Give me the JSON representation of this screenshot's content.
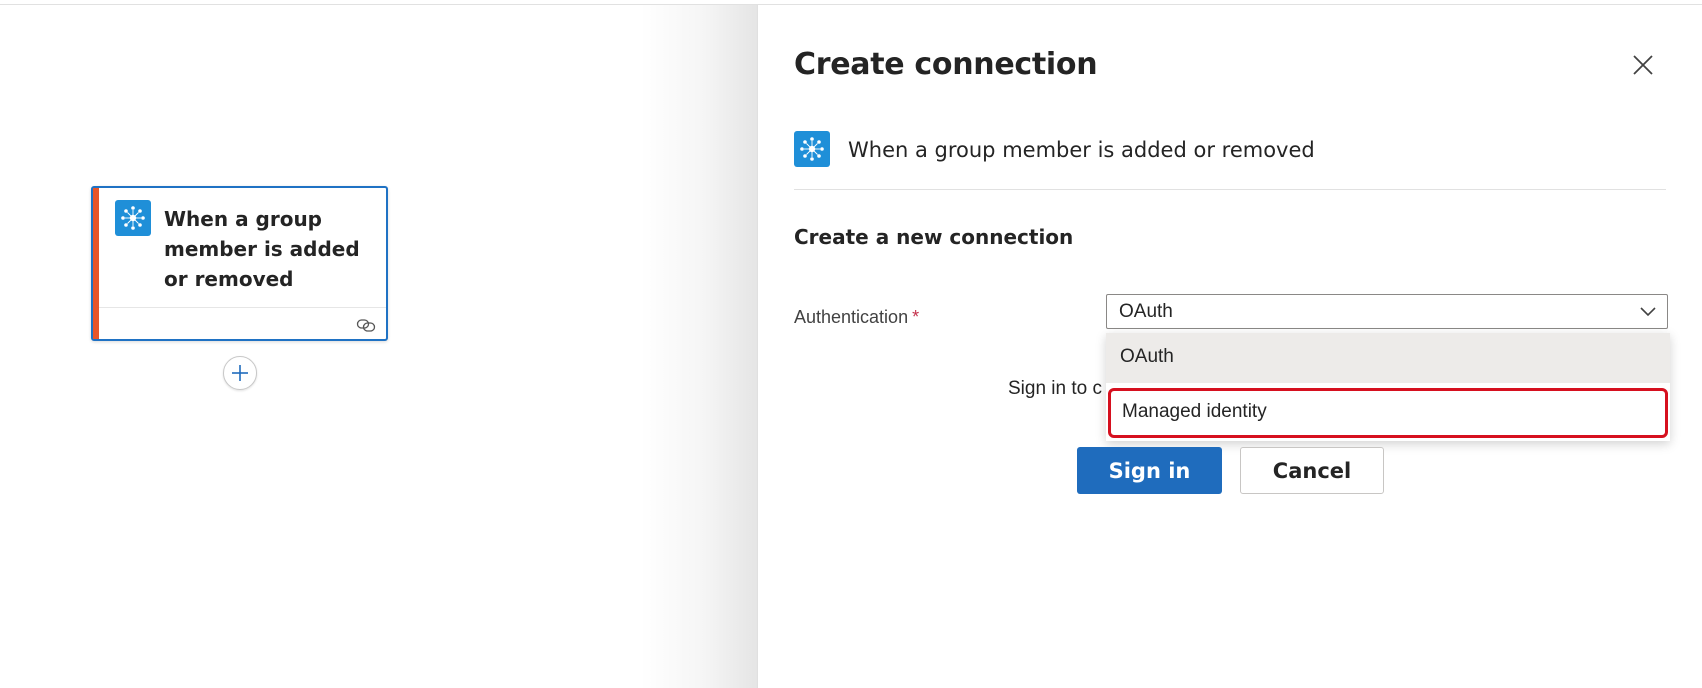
{
  "canvas": {
    "trigger_card": {
      "title": "When a group member is added or removed",
      "icon": "entra-id-hub-icon",
      "footer_icon": "connection-link-icon",
      "accent_color": "#e8562a",
      "border_color": "#1f72c4"
    },
    "add_step_icon": "plus-icon"
  },
  "panel": {
    "title": "Create connection",
    "close_icon": "close-icon",
    "operation": {
      "icon": "entra-id-hub-icon",
      "name": "When a group member is added or removed"
    },
    "section_heading": "Create a new connection",
    "authentication": {
      "label": "Authentication",
      "required_marker": "*",
      "selected_value": "OAuth",
      "options": [
        "OAuth",
        "Managed identity"
      ],
      "highlighted_option": "Managed identity"
    },
    "sign_in_text": "Sign in to c",
    "buttons": {
      "sign_in": "Sign in",
      "cancel": "Cancel"
    }
  },
  "colors": {
    "primary": "#1f6cbd",
    "highlight_border": "#d6101f",
    "icon_bg": "#1f8fd8"
  }
}
